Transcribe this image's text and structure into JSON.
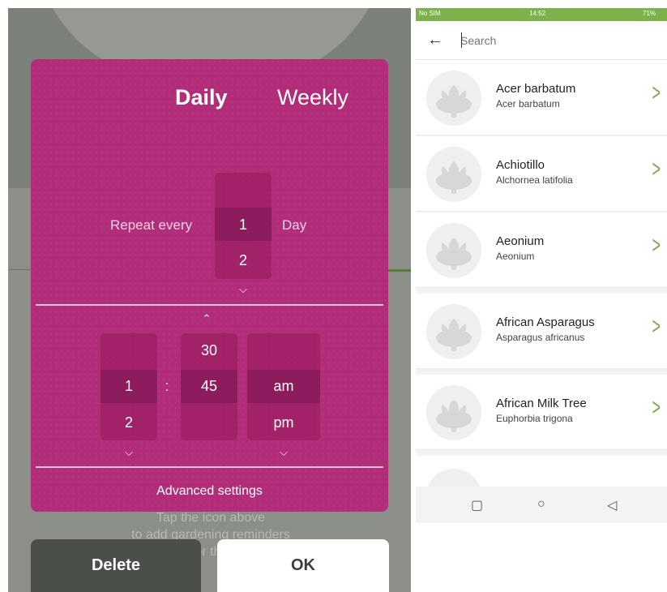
{
  "left": {
    "tabs": [
      "Daily",
      "Weekly"
    ],
    "repeat": {
      "label": "Repeat every",
      "selected": "1",
      "next": "2",
      "unit": "Day"
    },
    "time": {
      "hour": {
        "selected": "1",
        "next": "2"
      },
      "separator": ":",
      "minute": {
        "prev": "30",
        "selected": "45"
      },
      "ampm": {
        "selected": "am",
        "next": "pm"
      }
    },
    "advanced": "Advanced settings",
    "hint_lines": [
      "Tap the icon above",
      "to add gardening reminders",
      "for this"
    ],
    "delete": "Delete",
    "ok": "OK"
  },
  "right": {
    "status": {
      "carrier": "No SIM",
      "time": "14:52",
      "battery": "71%"
    },
    "search": {
      "placeholder": "Search",
      "back_icon": "arrow-left-icon"
    },
    "plants": [
      {
        "name": "Acer barbatum",
        "sci": "Acer barbatum"
      },
      {
        "name": "Achiotillo",
        "sci": "Alchornea latifolia"
      },
      {
        "name": "Aeonium",
        "sci": "Aeonium"
      },
      {
        "name": "African Asparagus",
        "sci": "Asparagus africanus"
      },
      {
        "name": "African Milk Tree",
        "sci": "Euphorbia trigona"
      }
    ],
    "nav": [
      "square-icon",
      "circle-icon",
      "triangle-back-icon"
    ],
    "colors": {
      "accent": "#b22d79",
      "green": "#7db14b"
    }
  }
}
